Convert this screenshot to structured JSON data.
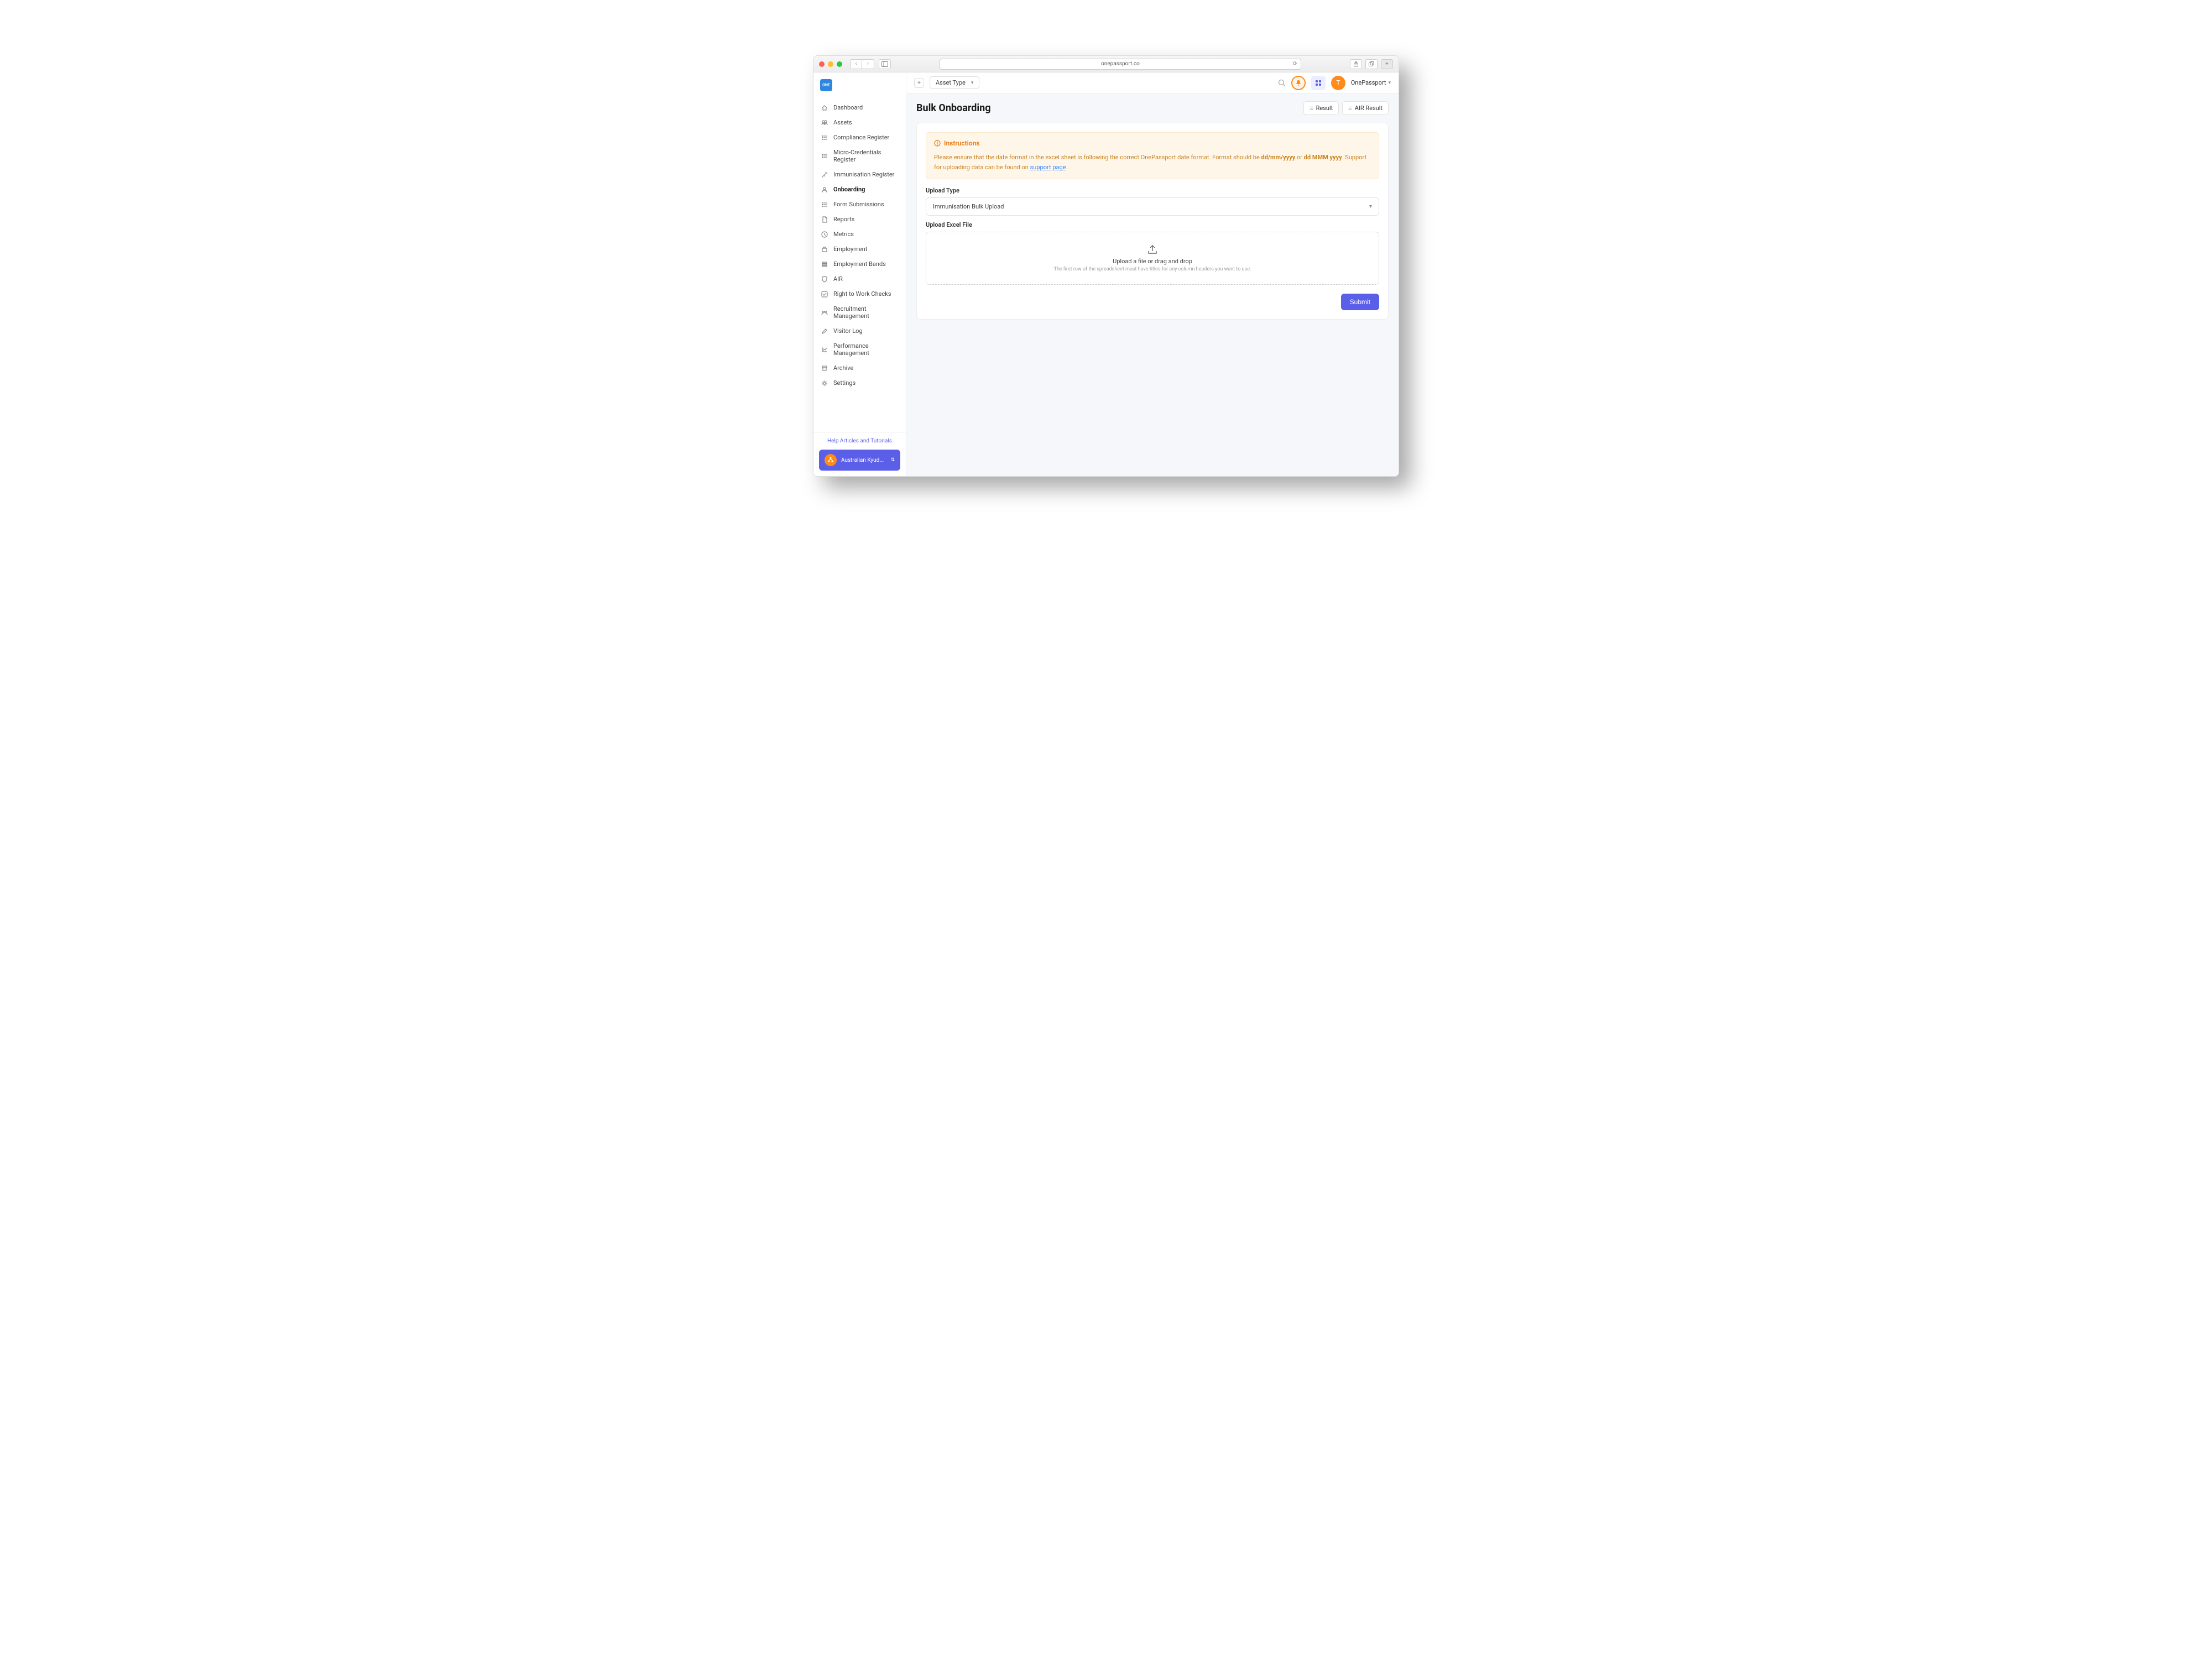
{
  "browser": {
    "url": "onepassport.co"
  },
  "logo_text": "ONE",
  "sidebar": {
    "items": [
      {
        "label": "Dashboard",
        "icon": "home"
      },
      {
        "label": "Assets",
        "icon": "people"
      },
      {
        "label": "Compliance Register",
        "icon": "list"
      },
      {
        "label": "Micro-Credentials Register",
        "icon": "list"
      },
      {
        "label": "Immunisation Register",
        "icon": "syringe"
      },
      {
        "label": "Onboarding",
        "icon": "person",
        "active": true
      },
      {
        "label": "Form Submissions",
        "icon": "list"
      },
      {
        "label": "Reports",
        "icon": "doc"
      },
      {
        "label": "Metrics",
        "icon": "clock"
      },
      {
        "label": "Employment",
        "icon": "briefcase"
      },
      {
        "label": "Employment Bands",
        "icon": "bands"
      },
      {
        "label": "AIR",
        "icon": "shield"
      },
      {
        "label": "Right to Work Checks",
        "icon": "check"
      },
      {
        "label": "Recruitment Management",
        "icon": "group"
      },
      {
        "label": "Visitor Log",
        "icon": "pencil"
      },
      {
        "label": "Performance Management",
        "icon": "chart"
      },
      {
        "label": "Archive",
        "icon": "archive"
      },
      {
        "label": "Settings",
        "icon": "gear"
      }
    ],
    "help_link": "Help Articles and Tutorials",
    "org_name": "Australian Kyud..."
  },
  "topbar": {
    "asset_type_label": "Asset Type",
    "user_name": "OnePassport",
    "user_initial": "T"
  },
  "page": {
    "title": "Bulk Onboarding",
    "result_btn": "Result",
    "air_result_btn": "AIR Result"
  },
  "instructions": {
    "heading": "Instructions",
    "body_prefix": "Please ensure that the date format in the excel sheet is following the correct OnePassport date format. Format should be ",
    "fmt1": "dd/mm/yyyy",
    "or": " or ",
    "fmt2": "dd MMM yyyy",
    "body_suffix": ". Support for uploading data can be found on ",
    "link": "support page",
    "tail": " ."
  },
  "form": {
    "upload_type_label": "Upload Type",
    "upload_type_value": "Immunisation Bulk Upload",
    "upload_file_label": "Upload Excel File",
    "dropzone_title": "Upload a file or drag and drop",
    "dropzone_sub": "The first row of the spreadsheet must have titles for any column headers you want to use.",
    "submit": "Submit"
  }
}
